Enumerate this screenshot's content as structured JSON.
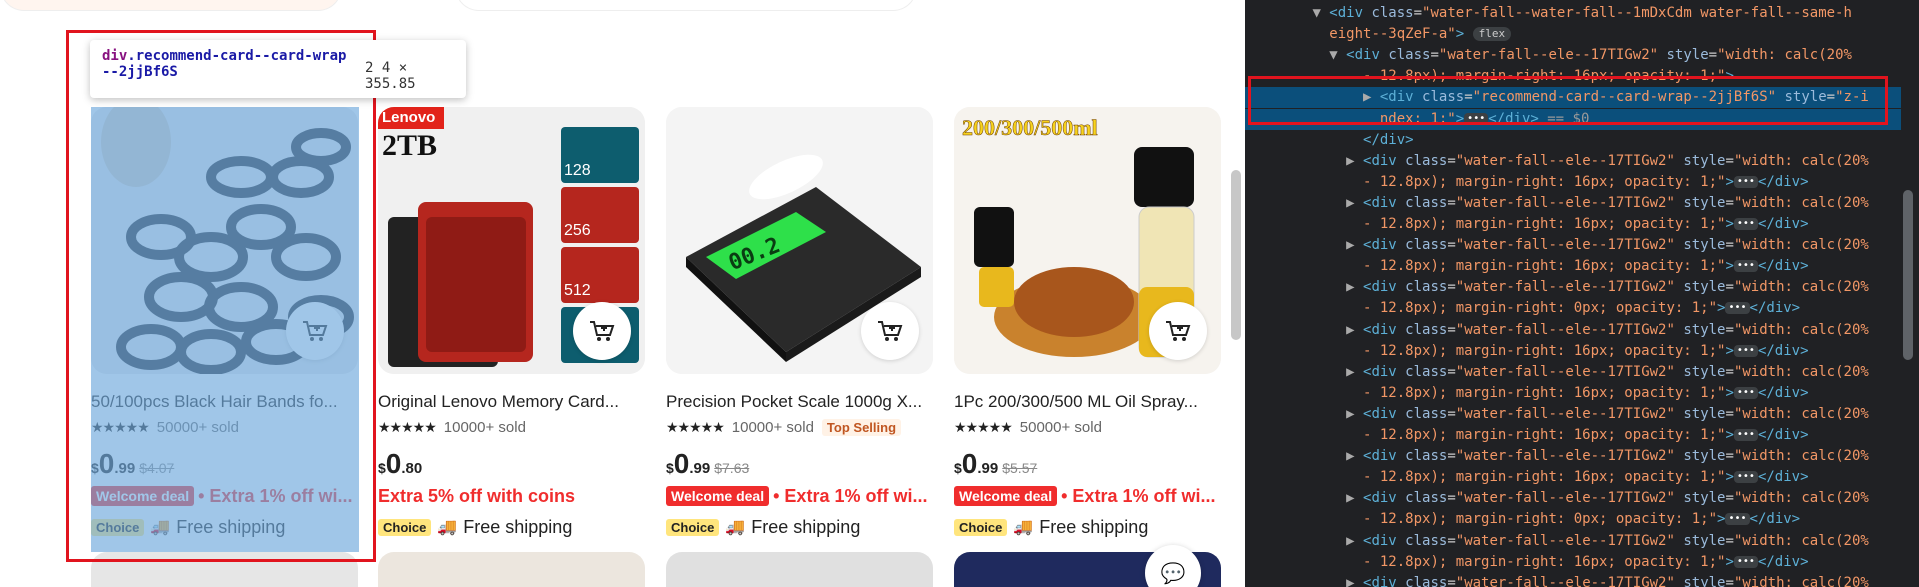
{
  "inspector": {
    "tooltip_tag": "div",
    "tooltip_class_1": ".recommend-card--card-wrap",
    "tooltip_class_2": "--2jjBf6S",
    "tooltip_size": "2 4 × 355.85"
  },
  "products": [
    {
      "title": "50/100pcs Black Hair Bands fo...",
      "stars": "★★★★★",
      "sold": "50000+ sold",
      "badge": "",
      "price_cur": "$",
      "price_int": "0",
      "price_dec": ".99",
      "price_old": "$4.07",
      "welcome": "Welcome deal",
      "promo": "• Extra 1% off wi...",
      "choice": "Choice",
      "shipping": "Free shipping"
    },
    {
      "title": "Original Lenovo Memory Card...",
      "stars": "★★★★★",
      "sold": "10000+ sold",
      "badge": "",
      "price_cur": "$",
      "price_int": "0",
      "price_dec": ".80",
      "price_old": "",
      "welcome": "",
      "promo": "Extra 5% off with coins",
      "choice": "Choice",
      "shipping": "Free shipping",
      "brand_label": "Lenovo",
      "capacity_label": "2TB",
      "card_sizes": [
        "128",
        "256",
        "512"
      ]
    },
    {
      "title": "Precision Pocket Scale 1000g X...",
      "stars": "★★★★★",
      "sold": "10000+ sold",
      "badge": "Top Selling",
      "price_cur": "$",
      "price_int": "0",
      "price_dec": ".99",
      "price_old": "$7.63",
      "welcome": "Welcome deal",
      "promo": "• Extra 1% off wi...",
      "choice": "Choice",
      "shipping": "Free shipping",
      "display_reading": "00.2"
    },
    {
      "title": "1Pc 200/300/500 ML Oil Spray...",
      "stars": "★★★★★",
      "sold": "50000+ sold",
      "badge": "",
      "price_cur": "$",
      "price_int": "0",
      "price_dec": ".99",
      "price_old": "$5.57",
      "welcome": "Welcome deal",
      "promo": "• Extra 1% off wi...",
      "choice": "Choice",
      "shipping": "Free shipping",
      "banner": "200/300/500ml"
    }
  ],
  "devtools": {
    "lines": [
      {
        "indent": "        ",
        "arrow": "▼",
        "parts": [
          [
            "tg",
            "<div "
          ],
          [
            "an",
            "class"
          ],
          [
            "tx",
            "="
          ],
          [
            "av",
            "\"water-fall--water-fall--1mDxCdm water-fall--same-h"
          ]
        ]
      },
      {
        "indent": "        ",
        "arrow": " ",
        "parts": [
          [
            "av",
            "eight--3qZeF-a\""
          ],
          [
            "tg",
            ">"
          ]
        ],
        "pill": "flex"
      },
      {
        "indent": "          ",
        "arrow": "▼",
        "parts": [
          [
            "tg",
            "<div "
          ],
          [
            "an",
            "class"
          ],
          [
            "tx",
            "="
          ],
          [
            "av",
            "\"water-fall--ele--17TIGw2\" "
          ],
          [
            "an",
            "style"
          ],
          [
            "tx",
            "="
          ],
          [
            "av",
            "\"width: calc(20%"
          ]
        ]
      },
      {
        "indent": "            ",
        "arrow": " ",
        "parts": [
          [
            "av",
            "- 12.8px); margin-right: 16px; opacity: 1;\""
          ],
          [
            "tg",
            ">"
          ]
        ]
      },
      {
        "indent": "              ",
        "arrow": "▶",
        "parts": [
          [
            "tg",
            "<div "
          ],
          [
            "an",
            "class"
          ],
          [
            "tx",
            "="
          ],
          [
            "av",
            "\"recommend-card--card-wrap--2jjBf6S\" "
          ],
          [
            "an",
            "style"
          ],
          [
            "tx",
            "="
          ],
          [
            "av",
            "\"z-i"
          ]
        ],
        "sel": true
      },
      {
        "indent": "              ",
        "arrow": " ",
        "parts": [
          [
            "av",
            "ndex: 1;\""
          ],
          [
            "tg",
            ">"
          ]
        ],
        "dots": true,
        "after": [
          [
            "tg",
            "</div>"
          ],
          [
            "tx",
            " == $0"
          ]
        ],
        "sel": true
      },
      {
        "indent": "            ",
        "arrow": " ",
        "parts": [
          [
            "tg",
            "</div>"
          ]
        ]
      },
      {
        "indent": "            ",
        "arrow": "▶",
        "parts": [
          [
            "tg",
            "<div "
          ],
          [
            "an",
            "class"
          ],
          [
            "tx",
            "="
          ],
          [
            "av",
            "\"water-fall--ele--17TIGw2\" "
          ],
          [
            "an",
            "style"
          ],
          [
            "tx",
            "="
          ],
          [
            "av",
            "\"width: calc(20%"
          ]
        ]
      },
      {
        "indent": "            ",
        "arrow": " ",
        "parts": [
          [
            "av",
            "- 12.8px); margin-right: 16px; opacity: 1;\""
          ],
          [
            "tg",
            ">"
          ]
        ],
        "dots": true,
        "after": [
          [
            "tg",
            "</div>"
          ]
        ]
      },
      {
        "indent": "            ",
        "arrow": "▶",
        "parts": [
          [
            "tg",
            "<div "
          ],
          [
            "an",
            "class"
          ],
          [
            "tx",
            "="
          ],
          [
            "av",
            "\"water-fall--ele--17TIGw2\" "
          ],
          [
            "an",
            "style"
          ],
          [
            "tx",
            "="
          ],
          [
            "av",
            "\"width: calc(20%"
          ]
        ]
      },
      {
        "indent": "            ",
        "arrow": " ",
        "parts": [
          [
            "av",
            "- 12.8px); margin-right: 16px; opacity: 1;\""
          ],
          [
            "tg",
            ">"
          ]
        ],
        "dots": true,
        "after": [
          [
            "tg",
            "</div>"
          ]
        ]
      },
      {
        "indent": "            ",
        "arrow": "▶",
        "parts": [
          [
            "tg",
            "<div "
          ],
          [
            "an",
            "class"
          ],
          [
            "tx",
            "="
          ],
          [
            "av",
            "\"water-fall--ele--17TIGw2\" "
          ],
          [
            "an",
            "style"
          ],
          [
            "tx",
            "="
          ],
          [
            "av",
            "\"width: calc(20%"
          ]
        ]
      },
      {
        "indent": "            ",
        "arrow": " ",
        "parts": [
          [
            "av",
            "- 12.8px); margin-right: 16px; opacity: 1;\""
          ],
          [
            "tg",
            ">"
          ]
        ],
        "dots": true,
        "after": [
          [
            "tg",
            "</div>"
          ]
        ]
      },
      {
        "indent": "            ",
        "arrow": "▶",
        "parts": [
          [
            "tg",
            "<div "
          ],
          [
            "an",
            "class"
          ],
          [
            "tx",
            "="
          ],
          [
            "av",
            "\"water-fall--ele--17TIGw2\" "
          ],
          [
            "an",
            "style"
          ],
          [
            "tx",
            "="
          ],
          [
            "av",
            "\"width: calc(20%"
          ]
        ]
      },
      {
        "indent": "            ",
        "arrow": " ",
        "parts": [
          [
            "av",
            "- 12.8px); margin-right: 0px; opacity: 1;\""
          ],
          [
            "tg",
            ">"
          ]
        ],
        "dots": true,
        "after": [
          [
            "tg",
            "</div>"
          ]
        ]
      },
      {
        "indent": "            ",
        "arrow": "▶",
        "parts": [
          [
            "tg",
            "<div "
          ],
          [
            "an",
            "class"
          ],
          [
            "tx",
            "="
          ],
          [
            "av",
            "\"water-fall--ele--17TIGw2\" "
          ],
          [
            "an",
            "style"
          ],
          [
            "tx",
            "="
          ],
          [
            "av",
            "\"width: calc(20%"
          ]
        ]
      },
      {
        "indent": "            ",
        "arrow": " ",
        "parts": [
          [
            "av",
            "- 12.8px); margin-right: 16px; opacity: 1;\""
          ],
          [
            "tg",
            ">"
          ]
        ],
        "dots": true,
        "after": [
          [
            "tg",
            "</div>"
          ]
        ]
      },
      {
        "indent": "            ",
        "arrow": "▶",
        "parts": [
          [
            "tg",
            "<div "
          ],
          [
            "an",
            "class"
          ],
          [
            "tx",
            "="
          ],
          [
            "av",
            "\"water-fall--ele--17TIGw2\" "
          ],
          [
            "an",
            "style"
          ],
          [
            "tx",
            "="
          ],
          [
            "av",
            "\"width: calc(20%"
          ]
        ]
      },
      {
        "indent": "            ",
        "arrow": " ",
        "parts": [
          [
            "av",
            "- 12.8px); margin-right: 16px; opacity: 1;\""
          ],
          [
            "tg",
            ">"
          ]
        ],
        "dots": true,
        "after": [
          [
            "tg",
            "</div>"
          ]
        ]
      },
      {
        "indent": "            ",
        "arrow": "▶",
        "parts": [
          [
            "tg",
            "<div "
          ],
          [
            "an",
            "class"
          ],
          [
            "tx",
            "="
          ],
          [
            "av",
            "\"water-fall--ele--17TIGw2\" "
          ],
          [
            "an",
            "style"
          ],
          [
            "tx",
            "="
          ],
          [
            "av",
            "\"width: calc(20%"
          ]
        ]
      },
      {
        "indent": "            ",
        "arrow": " ",
        "parts": [
          [
            "av",
            "- 12.8px); margin-right: 16px; opacity: 1;\""
          ],
          [
            "tg",
            ">"
          ]
        ],
        "dots": true,
        "after": [
          [
            "tg",
            "</div>"
          ]
        ]
      },
      {
        "indent": "            ",
        "arrow": "▶",
        "parts": [
          [
            "tg",
            "<div "
          ],
          [
            "an",
            "class"
          ],
          [
            "tx",
            "="
          ],
          [
            "av",
            "\"water-fall--ele--17TIGw2\" "
          ],
          [
            "an",
            "style"
          ],
          [
            "tx",
            "="
          ],
          [
            "av",
            "\"width: calc(20%"
          ]
        ]
      },
      {
        "indent": "            ",
        "arrow": " ",
        "parts": [
          [
            "av",
            "- 12.8px); margin-right: 16px; opacity: 1;\""
          ],
          [
            "tg",
            ">"
          ]
        ],
        "dots": true,
        "after": [
          [
            "tg",
            "</div>"
          ]
        ]
      },
      {
        "indent": "            ",
        "arrow": "▶",
        "parts": [
          [
            "tg",
            "<div "
          ],
          [
            "an",
            "class"
          ],
          [
            "tx",
            "="
          ],
          [
            "av",
            "\"water-fall--ele--17TIGw2\" "
          ],
          [
            "an",
            "style"
          ],
          [
            "tx",
            "="
          ],
          [
            "av",
            "\"width: calc(20%"
          ]
        ]
      },
      {
        "indent": "            ",
        "arrow": " ",
        "parts": [
          [
            "av",
            "- 12.8px); margin-right: 0px; opacity: 1;\""
          ],
          [
            "tg",
            ">"
          ]
        ],
        "dots": true,
        "after": [
          [
            "tg",
            "</div>"
          ]
        ]
      },
      {
        "indent": "            ",
        "arrow": "▶",
        "parts": [
          [
            "tg",
            "<div "
          ],
          [
            "an",
            "class"
          ],
          [
            "tx",
            "="
          ],
          [
            "av",
            "\"water-fall--ele--17TIGw2\" "
          ],
          [
            "an",
            "style"
          ],
          [
            "tx",
            "="
          ],
          [
            "av",
            "\"width: calc(20%"
          ]
        ]
      },
      {
        "indent": "            ",
        "arrow": " ",
        "parts": [
          [
            "av",
            "- 12.8px); margin-right: 16px; opacity: 1;\""
          ],
          [
            "tg",
            ">"
          ]
        ],
        "dots": true,
        "after": [
          [
            "tg",
            "</div>"
          ]
        ]
      },
      {
        "indent": "            ",
        "arrow": "▶",
        "parts": [
          [
            "tg",
            "<div "
          ],
          [
            "an",
            "class"
          ],
          [
            "tx",
            "="
          ],
          [
            "av",
            "\"water-fall--ele--17TIGw2\" "
          ],
          [
            "an",
            "style"
          ],
          [
            "tx",
            "="
          ],
          [
            "av",
            "\"width: calc(20%"
          ]
        ]
      }
    ]
  }
}
